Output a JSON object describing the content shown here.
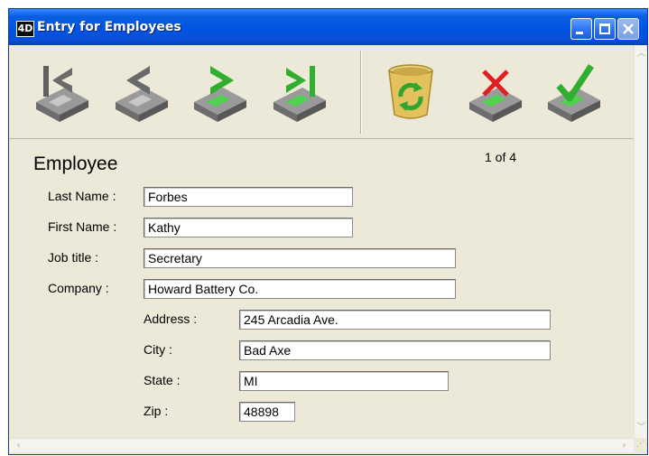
{
  "window": {
    "title": "Entry for Employees",
    "app_icon_glyph": "4D"
  },
  "toolbar": {
    "buttons": [
      {
        "name": "first-record-button",
        "icon": "first-record-drive-icon"
      },
      {
        "name": "previous-record-button",
        "icon": "previous-record-drive-icon"
      },
      {
        "name": "next-record-button",
        "icon": "next-record-drive-icon"
      },
      {
        "name": "last-record-button",
        "icon": "last-record-drive-icon"
      },
      {
        "name": "delete-record-button",
        "icon": "recycle-bin-icon"
      },
      {
        "name": "cancel-button",
        "icon": "cancel-x-drive-icon"
      },
      {
        "name": "accept-button",
        "icon": "accept-checkmark-drive-icon"
      }
    ]
  },
  "form": {
    "heading": "Employee",
    "record_position": "1 of 4",
    "labels": {
      "last_name": "Last Name :",
      "first_name": "First Name :",
      "job_title": "Job title :",
      "company": "Company :",
      "address": "Address :",
      "city": "City :",
      "state": "State :",
      "zip": "Zip :"
    },
    "values": {
      "last_name": "Forbes",
      "first_name": "Kathy",
      "job_title": "Secretary",
      "company": "Howard Battery Co.",
      "address": "245 Arcadia Ave.",
      "city": "Bad Axe",
      "state": "MI",
      "zip": "48898"
    }
  },
  "colors": {
    "titlebar": "#0054e3",
    "window_bg": "#ece9d8",
    "drive_green": "#3ec43e",
    "delete_red": "#e02020"
  }
}
